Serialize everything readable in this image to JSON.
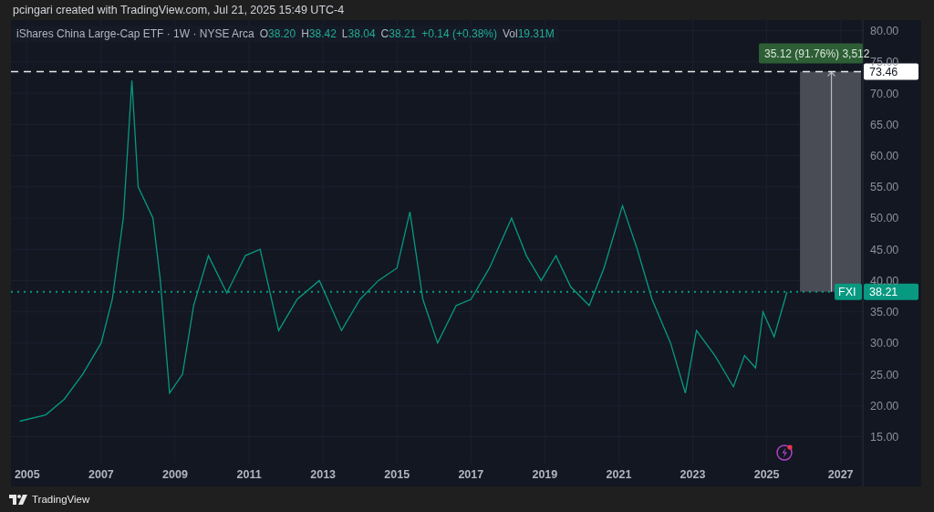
{
  "attribution": "pcingari created with TradingView.com, Jul 21, 2025 15:49 UTC-4",
  "legend": {
    "title": "iShares China Large-Cap ETF · 1W · NYSE Arca",
    "fields": [
      {
        "label": "O",
        "value": "38.20"
      },
      {
        "label": "H",
        "value": "38.42"
      },
      {
        "label": "L",
        "value": "38.04"
      },
      {
        "label": "C",
        "value": "38.21"
      }
    ],
    "change": "+0.14 (+0.38%)",
    "volume": {
      "label": "Vol",
      "value": "19.31M"
    }
  },
  "chart": {
    "chart_data": {
      "type": "line",
      "xlim": [
        2004.56,
        2027.6
      ],
      "ylim": [
        10.7,
        81.7
      ],
      "xticks": [
        {
          "value": 2005,
          "label": "2005"
        },
        {
          "value": 2007,
          "label": "2007"
        },
        {
          "value": 2009,
          "label": "2009"
        },
        {
          "value": 2011,
          "label": "2011"
        },
        {
          "value": 2013,
          "label": "2013"
        },
        {
          "value": 2015,
          "label": "2015"
        },
        {
          "value": 2017,
          "label": "2017"
        },
        {
          "value": 2019,
          "label": "2019"
        },
        {
          "value": 2021,
          "label": "2021"
        },
        {
          "value": 2023,
          "label": "2023"
        },
        {
          "value": 2025,
          "label": "2025"
        },
        {
          "value": 2027,
          "label": "2027"
        }
      ],
      "yticks": [
        {
          "value": 15,
          "label": "15.00"
        },
        {
          "value": 20,
          "label": "20.00"
        },
        {
          "value": 25,
          "label": "25.00"
        },
        {
          "value": 30,
          "label": "30.00"
        },
        {
          "value": 35,
          "label": "35.00"
        },
        {
          "value": 40,
          "label": "40.00"
        },
        {
          "value": 45,
          "label": "45.00"
        },
        {
          "value": 50,
          "label": "50.00"
        },
        {
          "value": 55,
          "label": "55.00"
        },
        {
          "value": 60,
          "label": "60.00"
        },
        {
          "value": 65,
          "label": "65.00"
        },
        {
          "value": 70,
          "label": "70.00"
        },
        {
          "value": 75,
          "label": "75.00"
        },
        {
          "value": 80,
          "label": "80.00"
        }
      ],
      "x": [
        2004.8,
        2005.5,
        2006.0,
        2006.5,
        2007.0,
        2007.3,
        2007.6,
        2007.83,
        2008.0,
        2008.4,
        2008.6,
        2008.85,
        2009.2,
        2009.5,
        2009.9,
        2010.4,
        2010.9,
        2011.3,
        2011.8,
        2012.3,
        2012.9,
        2013.5,
        2014.0,
        2014.5,
        2015.0,
        2015.35,
        2015.7,
        2016.1,
        2016.6,
        2017.0,
        2017.5,
        2018.1,
        2018.5,
        2018.9,
        2019.3,
        2019.7,
        2020.2,
        2020.6,
        2021.1,
        2021.5,
        2021.9,
        2022.4,
        2022.8,
        2023.1,
        2023.6,
        2024.1,
        2024.4,
        2024.7,
        2024.9,
        2025.2,
        2025.55
      ],
      "series": [
        {
          "name": "FXI",
          "color": "#089981",
          "values": [
            17.5,
            18.5,
            21,
            25,
            30,
            37,
            50,
            72,
            55,
            50,
            40,
            22,
            25,
            36,
            44,
            38,
            44,
            45,
            32,
            37,
            40,
            32,
            37,
            40,
            42,
            51,
            37,
            30,
            36,
            37,
            42,
            50,
            44,
            40,
            44,
            39,
            36,
            42,
            52,
            45,
            37,
            30,
            22,
            32,
            28,
            23,
            28,
            26,
            35,
            31,
            38.2
          ]
        }
      ],
      "grid": true,
      "ref_lines": [
        {
          "axis": "y",
          "value": 73.46,
          "label": "73.46",
          "color": "#e8e8e8"
        },
        {
          "axis": "y",
          "value": 38.21,
          "label": "38.21",
          "color": "#089981"
        }
      ],
      "bands": [
        {
          "axis": "y",
          "from": 38.21,
          "to": 73.46
        }
      ],
      "annotations": [
        "35.12 (91.76%) 3,512"
      ]
    }
  },
  "footer": {
    "logo": "TradingView"
  }
}
